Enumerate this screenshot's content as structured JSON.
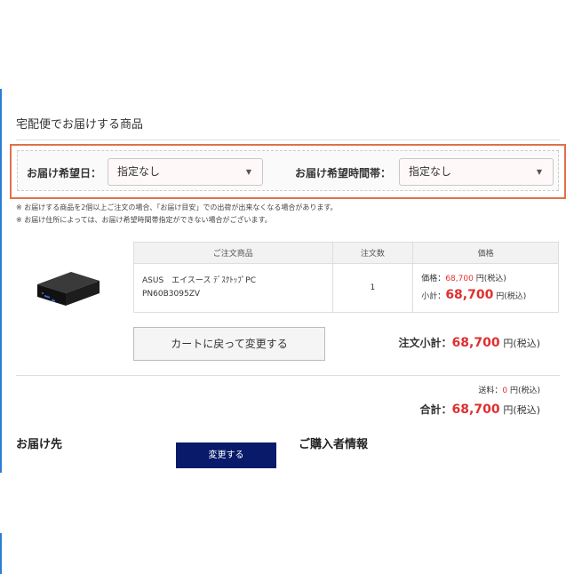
{
  "section": {
    "title": "宅配便でお届けする商品"
  },
  "delivery": {
    "date_label": "お届け希望日：",
    "date_value": "指定なし",
    "time_label": "お届け希望時間帯：",
    "time_value": "指定なし",
    "arrow": "▼"
  },
  "notes": [
    "※ お届けする商品を2個以上ご注文の場合、「お届け目安」での出荷が出来なくなる場合があります。",
    "※ お届け住所によっては、お届け希望時間帯指定ができない場合がございます。"
  ],
  "table": {
    "headers": [
      "ご注文商品",
      "注文数",
      "価格"
    ],
    "rows": [
      {
        "name_line1": "ASUS　エイスース ﾃﾞｽｸﾄｯﾌﾟPC",
        "name_line2": "PN60B3095ZV",
        "qty": "1",
        "price_label": "価格：",
        "price_value": "68,700",
        "price_unit": "円(税込)",
        "subtotal_label": "小計：",
        "subtotal_value": "68,700",
        "subtotal_unit": "円(税込)"
      }
    ]
  },
  "actions": {
    "back_to_cart": "カートに戻って変更する",
    "change": "変更する"
  },
  "summary": {
    "subtotal_label": "注文小計：",
    "subtotal_value": "68,700",
    "subtotal_unit": "円(税込)",
    "shipping_label": "送料：",
    "shipping_value": "0",
    "shipping_unit": "円(税込)",
    "total_label": "合計：",
    "total_value": "68,700",
    "total_unit": "円(税込)"
  },
  "headings": {
    "deliver_to": "お届け先",
    "buyer_info": "ご購入者情報"
  },
  "colors": {
    "accent_red": "#e02f2f",
    "highlight_border": "#e0714b",
    "button_navy": "#0a1a6b",
    "left_rule": "#2a7fd4"
  }
}
